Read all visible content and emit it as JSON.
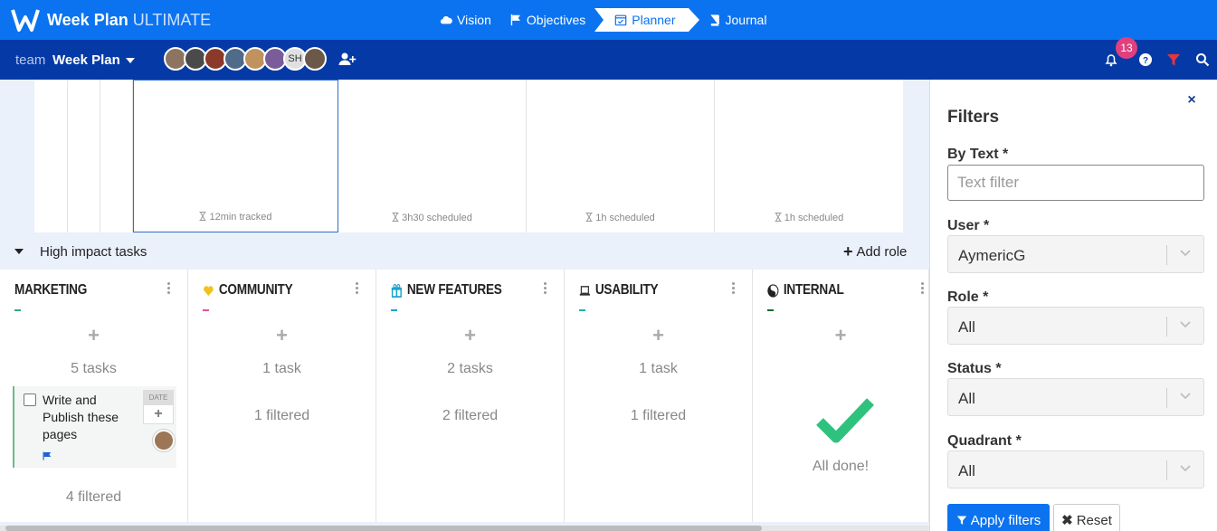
{
  "app": {
    "brand_name": "Week Plan",
    "brand_edition": "ULTIMATE"
  },
  "nav": {
    "items": [
      {
        "label": "Vision",
        "icon": "cloud-icon"
      },
      {
        "label": "Objectives",
        "icon": "flag-icon"
      },
      {
        "label": "Planner",
        "icon": "calendar-check-icon",
        "active": true
      },
      {
        "label": "Journal",
        "icon": "book-icon"
      }
    ]
  },
  "subbar": {
    "team_label": "team",
    "team_name": "Week Plan",
    "member_initials": "SH",
    "notifications_count": "13"
  },
  "timeline": {
    "days": [
      {
        "label": "12min tracked",
        "selected": true
      },
      {
        "label": "3h30 scheduled"
      },
      {
        "label": "1h scheduled"
      },
      {
        "label": "1h scheduled"
      }
    ]
  },
  "section": {
    "title": "High impact tasks",
    "add_role_label": "Add role"
  },
  "roles": [
    {
      "name": "MARKETING",
      "accent": "#3aa876",
      "count": "5 tasks",
      "filtered": "4 filtered",
      "icon": ""
    },
    {
      "name": "COMMUNITY",
      "accent": "#e0559b",
      "count": "1 task",
      "filtered": "1 filtered",
      "icon": "heart-icon"
    },
    {
      "name": "NEW FEATURES",
      "accent": "#1aa3c8",
      "count": "2 tasks",
      "filtered": "2 filtered",
      "icon": "gift-icon"
    },
    {
      "name": "USABILITY",
      "accent": "#1ab3b3",
      "count": "1 task",
      "filtered": "1 filtered",
      "icon": "laptop-icon"
    },
    {
      "name": "INTERNAL",
      "accent": "#1a6b2a",
      "count": "",
      "filtered": "",
      "icon": "yin-yang-icon",
      "done_label": "All done!"
    }
  ],
  "task": {
    "title": "Write and Publish these pages",
    "date_label": "DATE"
  },
  "filters": {
    "title": "Filters",
    "by_text_label": "By Text *",
    "text_placeholder": "Text filter",
    "user_label": "User *",
    "user_value": "AymericG",
    "role_label": "Role *",
    "role_value": "All",
    "status_label": "Status *",
    "status_value": "All",
    "quadrant_label": "Quadrant *",
    "quadrant_value": "All",
    "apply_label": "Apply filters",
    "reset_label": "Reset"
  }
}
